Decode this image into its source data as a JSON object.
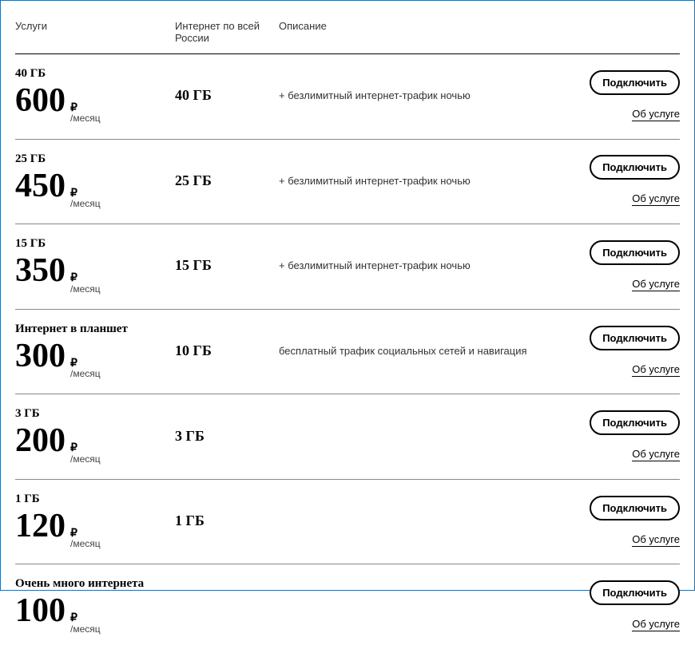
{
  "headers": {
    "services": "Услуги",
    "internet": "Интернет по всей России",
    "description": "Описание"
  },
  "labels": {
    "ruble": "₽",
    "per_month": "/месяц",
    "connect": "Подключить",
    "about": "Об услуге"
  },
  "plans": [
    {
      "title": "40 ГБ",
      "price": "600",
      "internet": "40 ГБ",
      "desc": "+ безлимитный интернет-трафик ночью"
    },
    {
      "title": "25 ГБ",
      "price": "450",
      "internet": "25 ГБ",
      "desc": "+ безлимитный интернет-трафик ночью"
    },
    {
      "title": "15 ГБ",
      "price": "350",
      "internet": "15 ГБ",
      "desc": "+ безлимитный интернет-трафик ночью"
    },
    {
      "title": "Интернет в планшет",
      "price": "300",
      "internet": "10 ГБ",
      "desc": "бесплатный трафик социальных сетей и навигация"
    },
    {
      "title": "3 ГБ",
      "price": "200",
      "internet": "3 ГБ",
      "desc": ""
    },
    {
      "title": "1 ГБ",
      "price": "120",
      "internet": "1 ГБ",
      "desc": ""
    },
    {
      "title": "Очень много интернета",
      "price": "100",
      "internet": "",
      "desc": ""
    }
  ]
}
